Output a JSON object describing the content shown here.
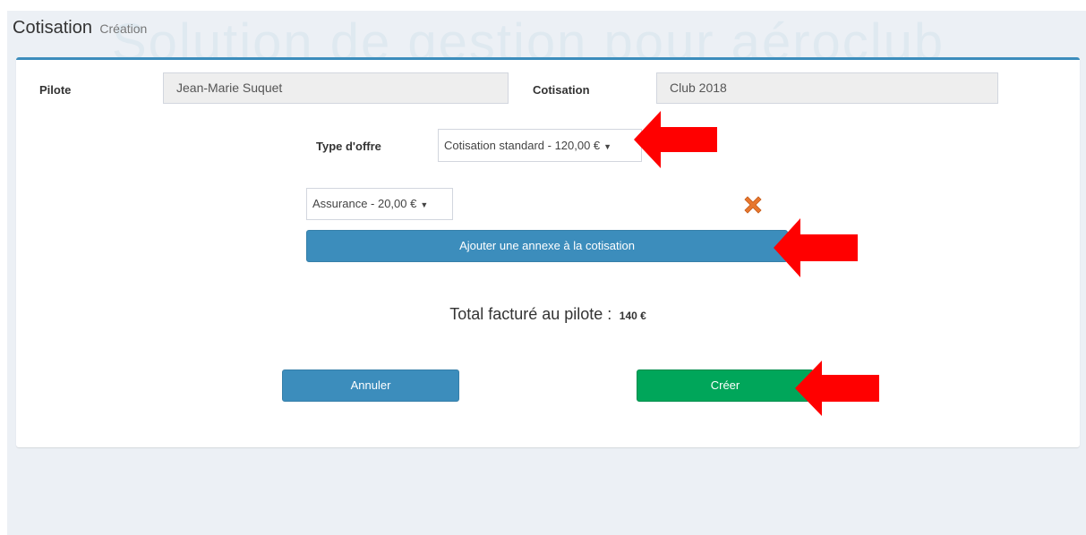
{
  "header": {
    "title": "Cotisation",
    "subtitle": "Création"
  },
  "form": {
    "pilote_label": "Pilote",
    "pilote_value": "Jean-Marie Suquet",
    "cotisation_label": "Cotisation",
    "cotisation_value": "Club 2018",
    "offer_type_label": "Type d'offre",
    "offer_type_selected": "Cotisation standard - 120,00 €",
    "annex_selected": "Assurance - 20,00 €",
    "add_annex_label": "Ajouter une annexe à la cotisation",
    "total_label": "Total facturé au pilote :",
    "total_value": "140 €"
  },
  "actions": {
    "cancel_label": "Annuler",
    "create_label": "Créer"
  },
  "colors": {
    "primary": "#3c8dbc",
    "success": "#00a65a",
    "remove_icon": "#e8772e",
    "annotation_arrow": "#ff0000"
  },
  "icons": [
    "close-icon",
    "chevron-down-icon",
    "annotation-arrow-icon"
  ]
}
